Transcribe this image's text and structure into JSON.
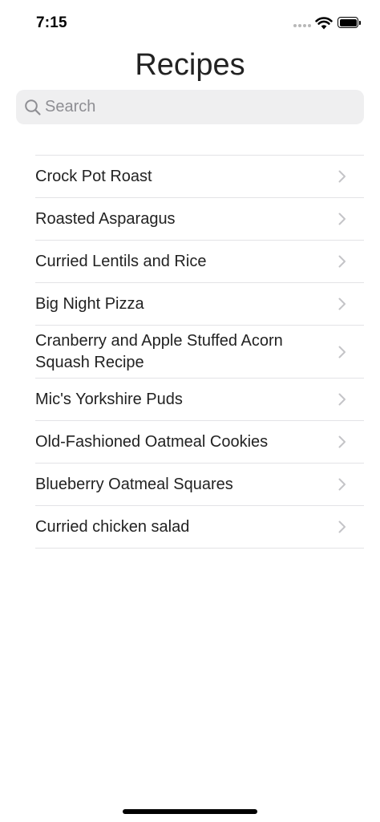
{
  "status_bar": {
    "time": "7:15",
    "icons": [
      "signal-dots",
      "wifi-icon",
      "battery-icon"
    ]
  },
  "nav": {
    "title": "Recipes"
  },
  "search": {
    "placeholder": "Search",
    "value": ""
  },
  "recipes": [
    {
      "label": "Crock Pot Roast"
    },
    {
      "label": "Roasted Asparagus"
    },
    {
      "label": "Curried Lentils and Rice"
    },
    {
      "label": "Big Night Pizza"
    },
    {
      "label": "Cranberry and Apple Stuffed Acorn Squash Recipe"
    },
    {
      "label": "Mic's Yorkshire Puds"
    },
    {
      "label": "Old-Fashioned Oatmeal Cookies"
    },
    {
      "label": "Blueberry Oatmeal Squares"
    },
    {
      "label": "Curried chicken salad"
    }
  ],
  "colors": {
    "text": "#222222",
    "separator": "#e3e3e6",
    "search_background": "#efeff0",
    "placeholder": "#8e8e93",
    "chevron": "#c4c4c7"
  }
}
